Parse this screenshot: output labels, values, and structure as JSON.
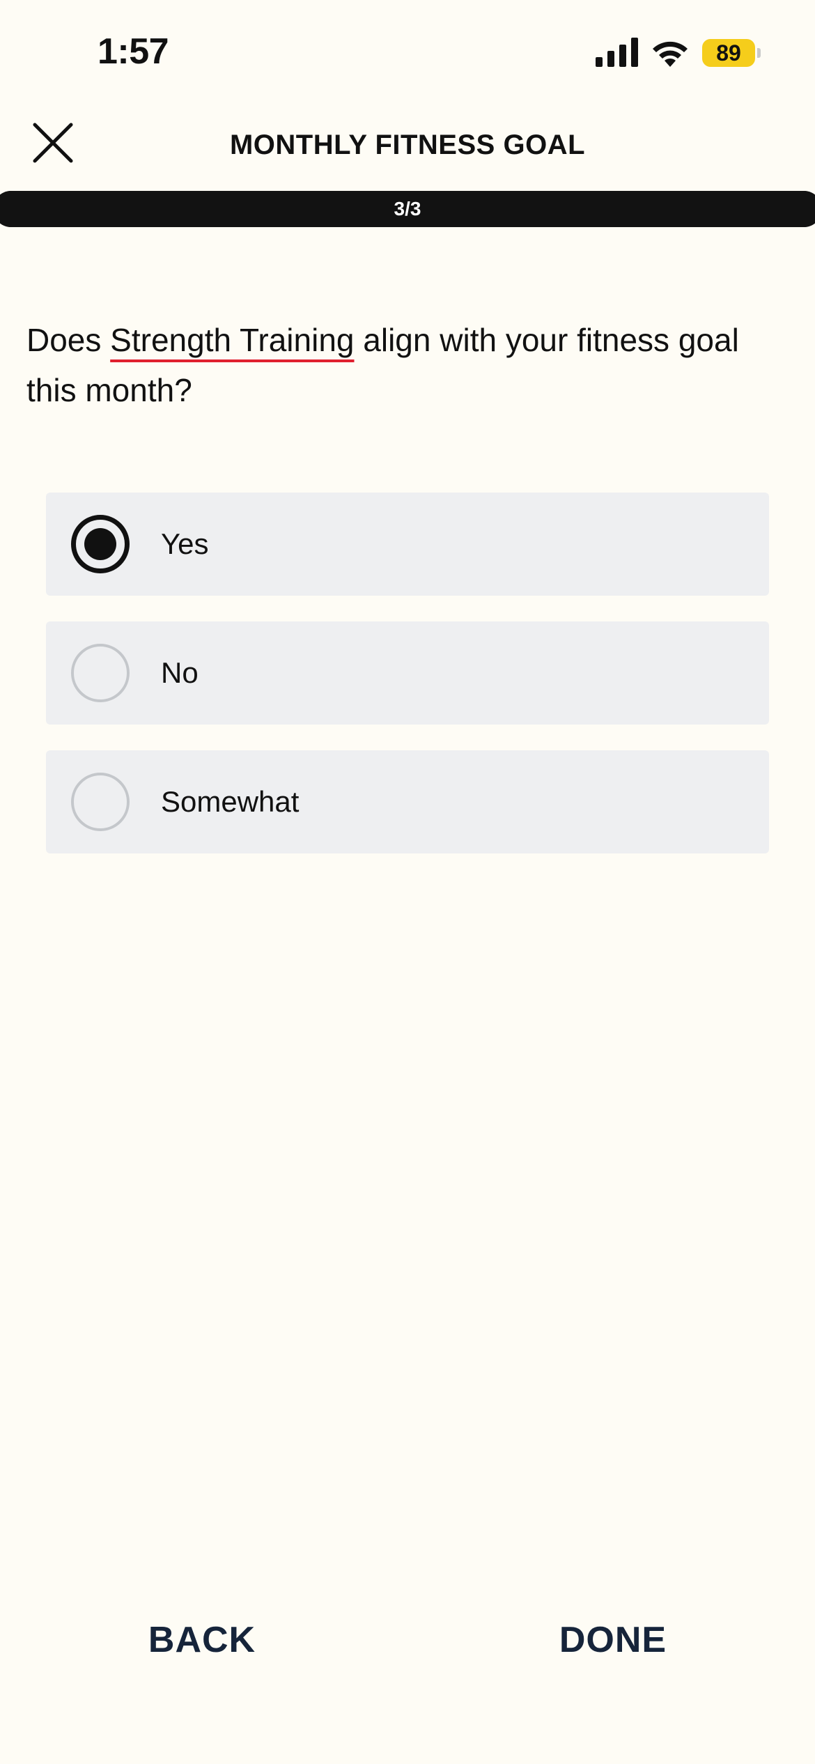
{
  "status_bar": {
    "time": "1:57",
    "battery_level": "89",
    "battery_color": "#F5CD1B"
  },
  "header": {
    "title": "MONTHLY FITNESS GOAL",
    "close_icon": "close-icon"
  },
  "progress": {
    "label": "3/3",
    "fraction": 1.0
  },
  "question": {
    "prefix": "Does ",
    "highlight": "Strength Training",
    "suffix": " align with your fitness goal this month?",
    "highlight_underline_color": "#E0202E"
  },
  "options": [
    {
      "label": "Yes",
      "selected": true
    },
    {
      "label": "No",
      "selected": false
    },
    {
      "label": "Somewhat",
      "selected": false
    }
  ],
  "footer": {
    "back_label": "BACK",
    "done_label": "DONE"
  }
}
